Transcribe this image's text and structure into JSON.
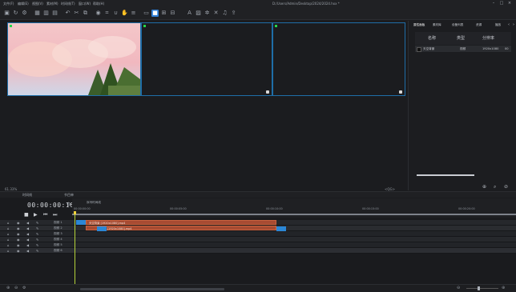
{
  "menu": [
    "文件(F)",
    "编辑(E)",
    "视图(V)",
    "素材(M)",
    "时间线(T)",
    "窗口(W)",
    "帮助(H)"
  ],
  "window_title": "D:/Users/Admin/Desktop/2024/2024.hxx *",
  "right_panel": {
    "tabs": [
      "属性面板",
      "素材库",
      "设备列表",
      "资源",
      "播放"
    ],
    "columns": [
      "名称",
      "类型",
      "分辨率"
    ],
    "row": {
      "name": "天空背景",
      "type": "视频",
      "resolution": "1920x1080",
      "extra": "00"
    }
  },
  "preview": {
    "zoom": "61.33%",
    "cmd": "<QG>"
  },
  "bottom_tabs": [
    "时间线",
    "节目单"
  ],
  "timecode": "00:00:00:16",
  "sequence_tab": "序列时间线",
  "ruler_labels": [
    "00:00:00:00",
    "00:00:05:00",
    "00:00:10:00",
    "00:00:15:00",
    "00:00:20:00"
  ],
  "tracks": [
    "视频 1",
    "视频 2",
    "视频 3",
    "视频 4",
    "视频 5",
    "视频 6"
  ],
  "clips": {
    "clip1": "天空背景 [1920x1080].mp4",
    "clip2": "天空 [1920x1080].mp4"
  },
  "colors": {
    "accent": "#2f7fd6",
    "clip": "#a84b32",
    "playhead": "#b5d33a",
    "viewport_border": "#1f6ea8"
  }
}
